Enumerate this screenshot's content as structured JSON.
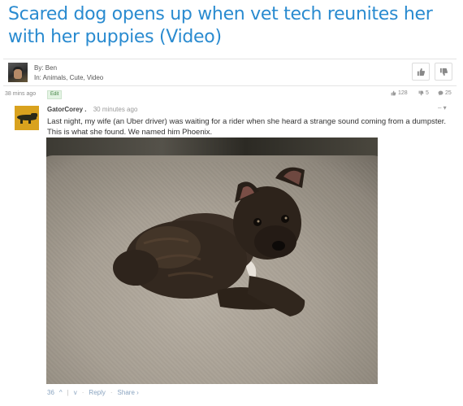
{
  "article": {
    "title": "Scared dog opens up when vet tech reunites her with her puppies (Video)",
    "by": "By: Ben",
    "in": "In: Animals, Cute, Video",
    "posted_ago": "38 mins ago",
    "edit_label": "Edit",
    "upvote_icon": "thumbs-up-icon",
    "downvote_icon": "thumbs-down-icon",
    "stats": {
      "likes": "128",
      "dislikes": "5",
      "comments": "25"
    }
  },
  "comment": {
    "user": "GatorCorey .",
    "time": "30 minutes ago",
    "menu": "– ▾",
    "text": "Last night, my wife (an Uber driver) was waiting for a rider when she heard a strange sound coming from a dumpster. This is what she found. We named him Phoenix.",
    "footer": {
      "votes": "36",
      "up_glyph": "^",
      "down_glyph": "v",
      "reply": "Reply",
      "share": "Share ›"
    }
  },
  "colors": {
    "title": "#2a8bd0",
    "link": "#8aa4c0",
    "edit_bg": "#e3f3e3"
  }
}
